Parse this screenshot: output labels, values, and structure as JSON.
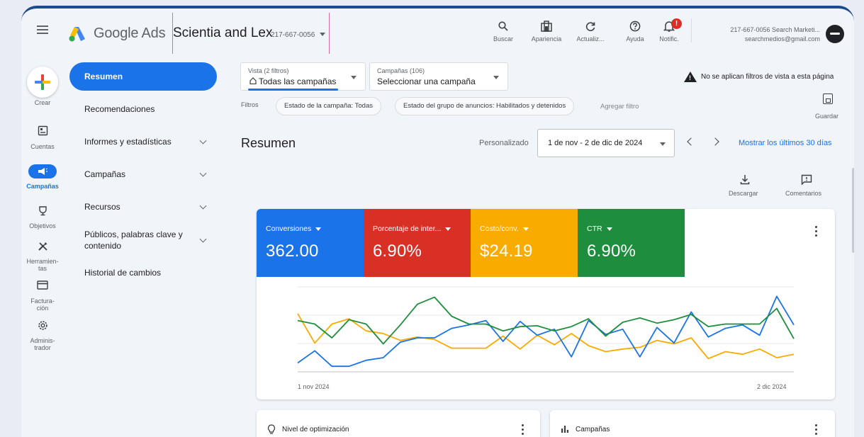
{
  "header": {
    "brand": "Google Ads",
    "account_name": "Scientia and Lex",
    "account_id": "217-667-0056",
    "tools": [
      {
        "label": "Buscar",
        "icon": "search-icon"
      },
      {
        "label": "Apariencia",
        "icon": "appearance-icon"
      },
      {
        "label": "Actualiz...",
        "icon": "refresh-icon"
      },
      {
        "label": "Ayuda",
        "icon": "help-icon"
      },
      {
        "label": "Notific.",
        "icon": "bell-icon"
      }
    ],
    "notification_badge": "!",
    "user_line1": "217-667-0056 Search Marketi...",
    "user_line2": "searchmedios@gmail.com"
  },
  "rail": {
    "create": "Crear",
    "items": [
      {
        "label": "Cuentas",
        "icon": "accounts-icon"
      },
      {
        "label": "Campañas",
        "icon": "campaigns-icon"
      },
      {
        "label": "Objetivos",
        "icon": "goals-icon"
      },
      {
        "label": "Herramien-tas",
        "icon": "tools-icon"
      },
      {
        "label": "Factura-ción",
        "icon": "billing-icon"
      },
      {
        "label": "Adminis-trador",
        "icon": "admin-icon"
      }
    ]
  },
  "nav": {
    "items": [
      {
        "label": "Resumen"
      },
      {
        "label": "Recomendaciones"
      },
      {
        "label": "Informes y estadísticas"
      },
      {
        "label": "Campañas"
      },
      {
        "label": "Recursos"
      },
      {
        "label": "Públicos, palabras clave y contenido"
      },
      {
        "label": "Historial de cambios"
      }
    ]
  },
  "filterbar": {
    "view_small": "Vista (2 filtros)",
    "view_big": "Todas las campañas",
    "campaign_small": "Campañas (106)",
    "campaign_big": "Seleccionar una campaña",
    "warning": "No se aplican filtros de vista a esta página",
    "filters_label": "Filtros",
    "chips": [
      "Estado de la campaña: Todas",
      "Estado del grupo de anuncios: Habilitados y detenidos"
    ],
    "add_filter": "Agregar filtro",
    "save": "Guardar"
  },
  "summary": {
    "title": "Resumen",
    "custom": "Personalizado",
    "date_range": "1 de nov - 2 de dic de 2024",
    "last30": "Mostrar los últimos 30 días",
    "download": "Descargar",
    "comments": "Comentarios"
  },
  "metrics": [
    {
      "label": "Conversiones",
      "value": "362.00",
      "color": "#1a73e8"
    },
    {
      "label": "Porcentaje de inter...",
      "value": "6.90%",
      "color": "#d93025"
    },
    {
      "label": "Costo/conv.",
      "value": "$24.19",
      "color": "#f9ab00"
    },
    {
      "label": "CTR",
      "value": "6.90%",
      "color": "#1e8e3e"
    }
  ],
  "chart_data": {
    "type": "line",
    "x_start_label": "1 nov 2024",
    "x_end_label": "2 dic 2024",
    "series": [
      {
        "name": "Conversiones",
        "color": "#1a73e8",
        "values": [
          0.12,
          0.26,
          0.08,
          0.08,
          0.15,
          0.18,
          0.36,
          0.41,
          0.41,
          0.52,
          0.56,
          0.61,
          0.37,
          0.6,
          0.44,
          0.51,
          0.19,
          0.61,
          0.45,
          0.51,
          0.19,
          0.53,
          0.35,
          0.71,
          0.42,
          0.52,
          0.56,
          0.44,
          0.89,
          0.56
        ]
      },
      {
        "name": "Porcentaje de interacción",
        "color": "#f9ab00",
        "values": [
          0.69,
          0.35,
          0.57,
          0.63,
          0.49,
          0.46,
          0.38,
          0.42,
          0.39,
          0.29,
          0.29,
          0.29,
          0.43,
          0.28,
          0.44,
          0.33,
          0.46,
          0.32,
          0.25,
          0.28,
          0.3,
          0.38,
          0.34,
          0.41,
          0.17,
          0.25,
          0.22,
          0.28,
          0.18,
          0.22
        ]
      },
      {
        "name": "Costo/conv.",
        "color": "#1e8e3e",
        "values": [
          0.61,
          0.57,
          0.41,
          0.62,
          0.57,
          0.34,
          0.56,
          0.8,
          0.88,
          0.66,
          0.57,
          0.57,
          0.49,
          0.54,
          0.55,
          0.49,
          0.54,
          0.63,
          0.43,
          0.59,
          0.64,
          0.58,
          0.62,
          0.68,
          0.54,
          0.57,
          0.57,
          0.57,
          0.75,
          0.4
        ]
      }
    ]
  },
  "bottom_cards": [
    {
      "title": "Nivel de optimización",
      "icon": "lightbulb-icon"
    },
    {
      "title": "Campañas",
      "icon": "bar-chart-icon"
    }
  ]
}
